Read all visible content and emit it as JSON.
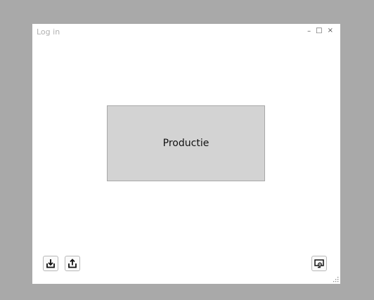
{
  "window": {
    "title": "Log in",
    "controls": {
      "minimize": "–",
      "maximize": "□",
      "close": "×"
    }
  },
  "main": {
    "button_label": "Productie"
  },
  "toolbar": {
    "import_icon": "download-tray-icon",
    "export_icon": "upload-tray-icon",
    "settings_icon": "display-settings-icon"
  }
}
